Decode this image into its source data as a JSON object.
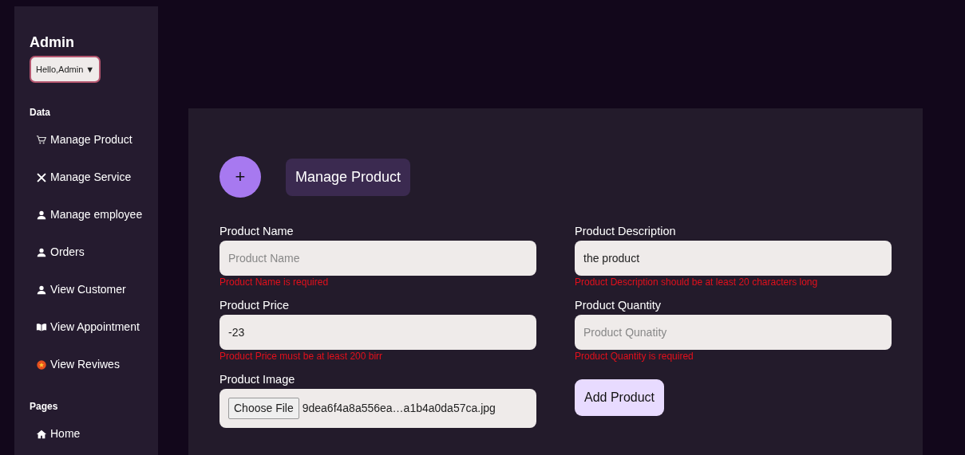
{
  "sidebar": {
    "title": "Admin",
    "user_menu": {
      "label": "Hello,Admin",
      "caret": "▼"
    },
    "sections": [
      {
        "heading": "Data",
        "items": [
          {
            "label": "Manage Product"
          },
          {
            "label": "Manage Service"
          },
          {
            "label": "Manage employee"
          },
          {
            "label": "Orders"
          },
          {
            "label": "View Customer"
          },
          {
            "label": "View Appointment"
          },
          {
            "label": "View Reviwes"
          }
        ]
      },
      {
        "heading": "Pages",
        "items": [
          {
            "label": "Home"
          }
        ]
      }
    ]
  },
  "main": {
    "add_button": "+",
    "heading": "Manage Product",
    "fields": [
      {
        "kind": "text",
        "label": "Product Name",
        "placeholder": "Product Name",
        "error": "Product Name is required"
      },
      {
        "kind": "text",
        "label": "Product Description",
        "value": "the product",
        "error": "Product Description should be at least 20 characters long"
      },
      {
        "kind": "text",
        "label": "Product Price",
        "value": "-23",
        "error": "Product Price must be at least 200 birr"
      },
      {
        "kind": "text",
        "label": "Product Quantity",
        "placeholder": "Product Qunatity",
        "error": "Product Quantity is required"
      },
      {
        "kind": "file",
        "label": "Product Image",
        "button": "Choose File",
        "value": "9dea6f4a8a556ea…a1b4a0da57ca.jpg"
      }
    ],
    "submit": "Add Product"
  }
}
